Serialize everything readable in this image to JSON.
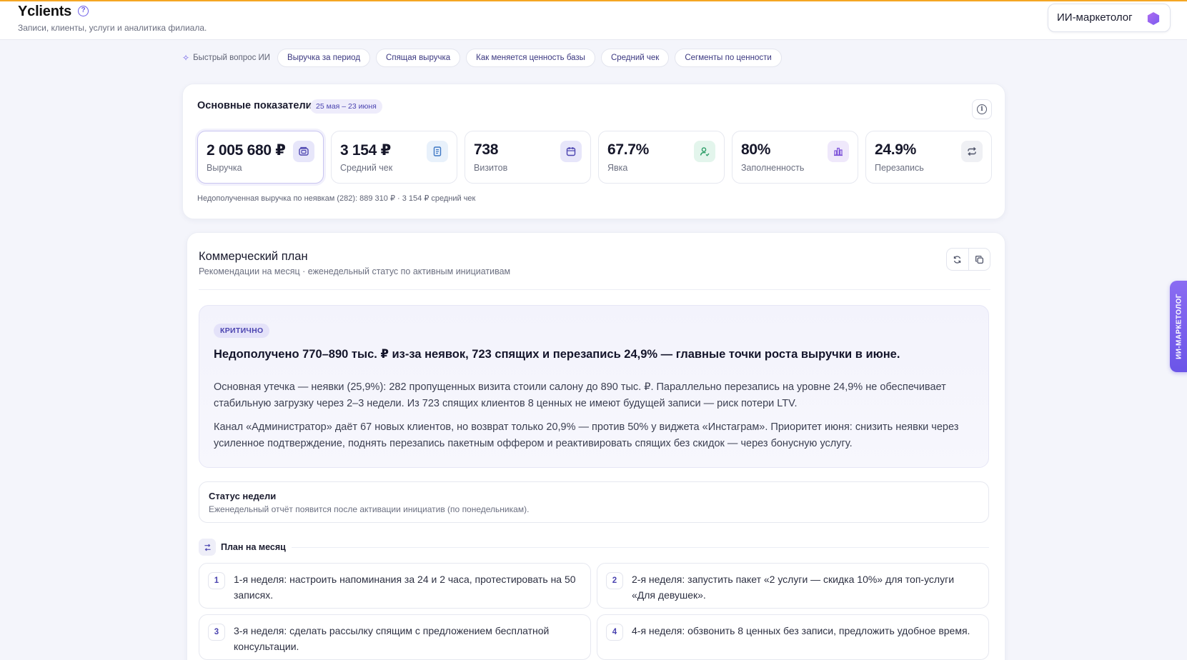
{
  "header": {
    "title": "Yclients",
    "subtitle": "Записи, клиенты, услуги и аналитика филиала.",
    "ai_button": "ИИ-маркетолог"
  },
  "quick": {
    "label": "Быстрый вопрос ИИ",
    "chips": [
      "Выручка за период",
      "Спящая выручка",
      "Как меняется ценность базы",
      "Средний чек",
      "Сегменты по ценности"
    ]
  },
  "kpi": {
    "title": "Основные показатели",
    "period": "25 мая – 23 июня",
    "metrics": [
      {
        "value": "2 005 680 ₽",
        "label": "Выручка",
        "icon": "wallet-icon"
      },
      {
        "value": "3 154 ₽",
        "label": "Средний чек",
        "icon": "receipt-icon"
      },
      {
        "value": "738",
        "label": "Визитов",
        "icon": "calendar-icon"
      },
      {
        "value": "67.7%",
        "label": "Явка",
        "icon": "user-check-icon"
      },
      {
        "value": "80%",
        "label": "Заполненность",
        "icon": "bar-chart-icon"
      },
      {
        "value": "24.9%",
        "label": "Перезапись",
        "icon": "repeat-icon"
      }
    ],
    "footnote": "Недополученная выручка по неявкам (282): 889 310 ₽ · 3 154 ₽ средний чек"
  },
  "plan": {
    "title": "Коммерческий план",
    "subtitle": "Рекомендации на месяц · еженедельный статус по активным инициативам",
    "critical": {
      "badge": "КРИТИЧНО",
      "headline": "Недополучено 770–890 тыс. ₽ из-за неявок, 723 спящих и перезапись 24,9% — главные точки роста выручки в июне.",
      "p1": "Основная утечка — неявки (25,9%): 282 пропущенных визита стоили салону до 890 тыс. ₽. Параллельно перезапись на уровне 24,9% не обеспечивает стабильную загрузку через 2–3 недели. Из 723 спящих клиентов 8 ценных не имеют будущей записи — риск потери LTV.",
      "p2": "Канал «Администратор» даёт 67 новых клиентов, но возврат только 20,9% — против 50% у виджета «Инстаграм». Приоритет июня: снизить неявки через усиленное подтверждение, поднять перезапись пакетным оффером и реактивировать спящих без скидок — через бонусную услугу."
    },
    "status": {
      "title": "Статус недели",
      "text": "Еженедельный отчёт появится после активации инициатив (по понедельникам)."
    },
    "month_label": "План на месяц",
    "steps": [
      {
        "num": "1",
        "text": "1-я неделя: настроить напоминания за 24 и 2 часа, протестировать на 50 записях."
      },
      {
        "num": "2",
        "text": "2-я неделя: запустить пакет «2 услуги — скидка 10%» для топ-услуги «Для девушек»."
      },
      {
        "num": "3",
        "text": "3-я неделя: сделать рассылку спящим с предложением бесплатной консультации."
      },
      {
        "num": "4",
        "text": "4-я неделя: обзвонить 8 ценных без записи, предложить удобное время."
      }
    ]
  },
  "side_tab": "ИИ-МАРКЕТОЛОГ",
  "colors": {
    "accent": "#6b5ce7",
    "top_line": "#f5a623",
    "background": "#f4f5fb"
  }
}
